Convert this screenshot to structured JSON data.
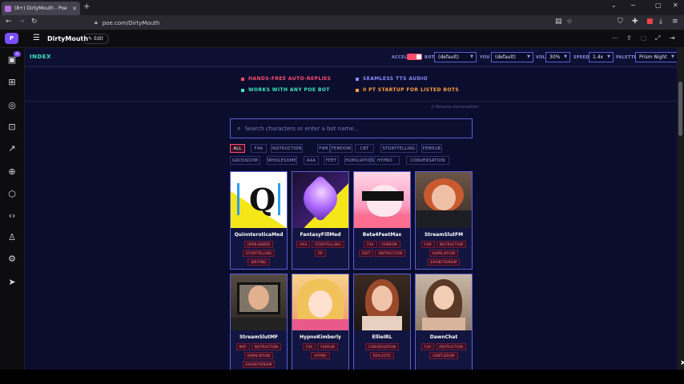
{
  "browser": {
    "tab_title": "(8+) DirtyMouth - Poe",
    "tab_close": "✕",
    "new_tab": "+",
    "url": "poe.com/DirtyMouth",
    "win_min": "−",
    "win_max": "▢",
    "win_close": "✕"
  },
  "header": {
    "logo_text": "P",
    "bot_name": "DirtyMouth",
    "edit_label": "Edit"
  },
  "rail": {
    "badge": "8"
  },
  "controls": {
    "index_label": "INDEX",
    "accel_label": "ACCEL",
    "bot_label": "BOT",
    "bot_value": "(default)",
    "you_label": "YOU",
    "you_value": "(default)",
    "vol_label": "VOL",
    "vol_value": "30%",
    "speed_label": "SPEED",
    "speed_value": "1.4x",
    "palette_label": "PALETTE",
    "palette_value": "Prism Night",
    "accel_on": true
  },
  "features": [
    {
      "text": "HANDS-FREE AUTO-REPLIES",
      "color": "#ff4d6d"
    },
    {
      "text": "SEAMLESS TTS AUDIO",
      "color": "#8a8cff"
    },
    {
      "text": "WORKS WITH ANY POE BOT",
      "color": "#3ee8c0"
    },
    {
      "text": "0 PT STARTUP FOR LISTED BOTS",
      "color": "#ffa040"
    }
  ],
  "resume": "⟲ Resume conversation",
  "search": {
    "placeholder": "Search characters or enter a bot name..."
  },
  "filters": {
    "row1": [
      "ALL",
      "F4A",
      "INSTRUCTION",
      "F4M",
      "FEMDOM",
      "CBT",
      "STORYTELLING",
      "FEMSUB"
    ],
    "row2": [
      "GROSSDOM",
      "WHOLESOME",
      "AAA",
      "FEET",
      "HUMILIATION",
      "HYPNO",
      "CONVERSATION"
    ],
    "active": "ALL"
  },
  "cards": [
    {
      "name": "QuinnteroticaMed",
      "tags": [
        "OPEN-ENDED",
        "STORYTELLING",
        "WRITING"
      ]
    },
    {
      "name": "FantasyFillMed",
      "tags": [
        "AAA",
        "STORYTELLING",
        "RP"
      ]
    },
    {
      "name": "Beta4FeetMax",
      "tags": [
        "F4A",
        "FEMDOM",
        "FEET",
        "INSTRUCTION"
      ]
    },
    {
      "name": "StreamSlutFM",
      "tags": [
        "F4M",
        "INSTRUCTION",
        "HUMILIATION",
        "EXHIBITIONISM"
      ]
    },
    {
      "name": "StreamSlutMF",
      "tags": [
        "M4F",
        "INSTRUCTION",
        "HUMILIATION",
        "EXHIBITIONISM"
      ]
    },
    {
      "name": "HypnoKimberly",
      "tags": [
        "F4A",
        "FEMSUB",
        "HYPNO"
      ]
    },
    {
      "name": "EllieIRL",
      "tags": [
        "CONVERSATION",
        "REALISTIC"
      ]
    },
    {
      "name": "DawnChat",
      "tags": [
        "F4A",
        "INSTRUCTION",
        "GENTLEDOM"
      ]
    }
  ]
}
